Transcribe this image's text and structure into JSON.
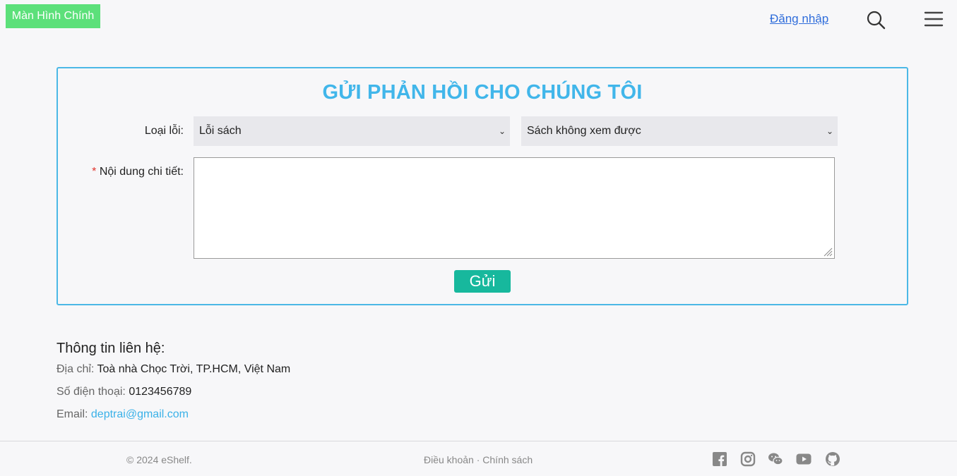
{
  "header": {
    "home_label": "Màn Hình Chính",
    "login_label": "Đăng nhập",
    "icons": [
      "search-icon",
      "menu-icon"
    ]
  },
  "feedback": {
    "title": "GỬI PHẢN HỒI CHO CHÚNG TÔI",
    "error_type_label": "Loại lỗi:",
    "error_category": "Lỗi sách",
    "error_subcategory": "Sách không xem được",
    "detail_required_mark": "*",
    "detail_label": "Nội dung chi tiết:",
    "detail_value": "",
    "submit_label": "Gửi"
  },
  "contact": {
    "title": "Thông tin liên hệ:",
    "address_label": "Địa chỉ:",
    "address_value": "Toà nhà Chọc Trời, TP.HCM, Việt Nam",
    "phone_label": "Số điện thoại:",
    "phone_value": "0123456789",
    "email_label": "Email:",
    "email_value": "deptrai@gmail.com"
  },
  "footer": {
    "copyright": "© 2024 eShelf.",
    "terms": "Điều khoản",
    "separator": "·",
    "policy": "Chính sách",
    "social_icons": [
      "facebook-icon",
      "instagram-icon",
      "wechat-icon",
      "youtube-icon",
      "github-icon"
    ]
  },
  "colors": {
    "home_button": "#5ce07a",
    "accent": "#41b6ea",
    "submit": "#17b89d",
    "link": "#2f6ddb"
  }
}
